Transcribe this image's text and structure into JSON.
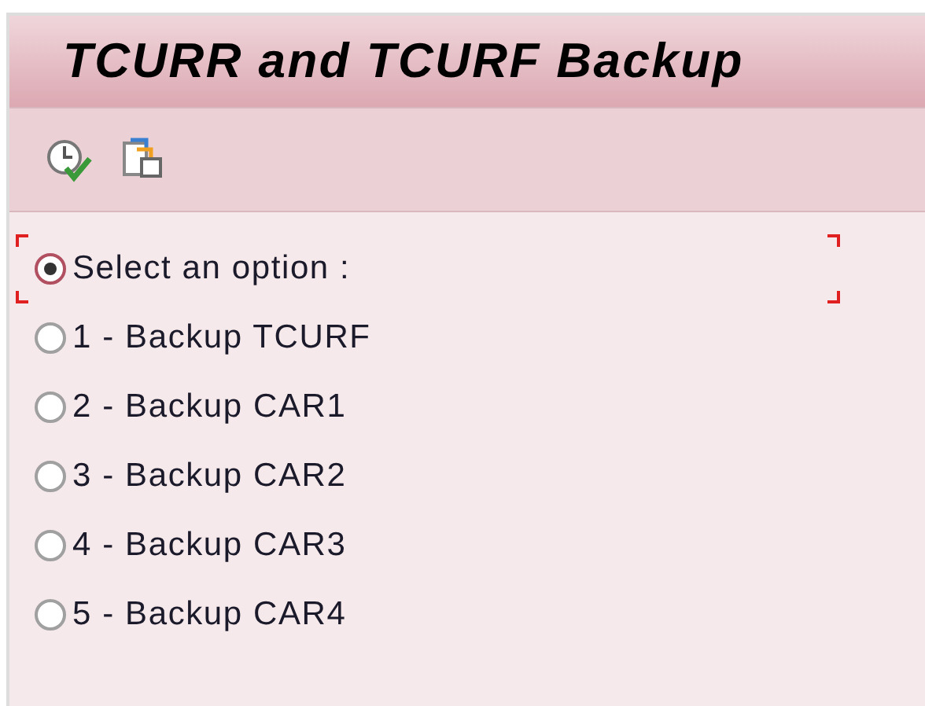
{
  "window": {
    "title": "TCURR and TCURF Backup"
  },
  "options": [
    {
      "label": "Select an option :",
      "selected": true,
      "focused": true
    },
    {
      "label": "1 - Backup TCURF",
      "selected": false,
      "focused": false
    },
    {
      "label": "2 - Backup CAR1",
      "selected": false,
      "focused": false
    },
    {
      "label": "3 - Backup CAR2",
      "selected": false,
      "focused": false
    },
    {
      "label": "4 - Backup CAR3",
      "selected": false,
      "focused": false
    },
    {
      "label": "5 - Backup CAR4",
      "selected": false,
      "focused": false
    }
  ]
}
